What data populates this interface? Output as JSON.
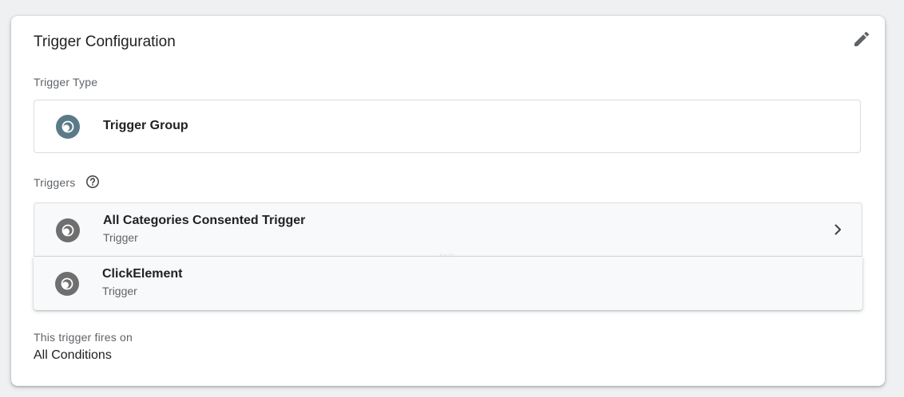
{
  "card": {
    "title": "Trigger Configuration",
    "edit_icon": "pencil-icon"
  },
  "trigger_type": {
    "label": "Trigger Type",
    "name": "Trigger Group",
    "icon": "trigger-group-icon",
    "icon_color": "#5b7a89"
  },
  "triggers": {
    "label": "Triggers",
    "help_icon": "help-circle-icon",
    "items": [
      {
        "name": "All Categories Consented Trigger",
        "type": "Trigger",
        "icon": "trigger-icon"
      },
      {
        "name": "ClickElement",
        "type": "Trigger",
        "icon": "trigger-icon"
      }
    ],
    "separator": "AND",
    "icon_color": "#6f6f6f"
  },
  "fires_on": {
    "label": "This trigger fires on",
    "value": "All Conditions"
  }
}
